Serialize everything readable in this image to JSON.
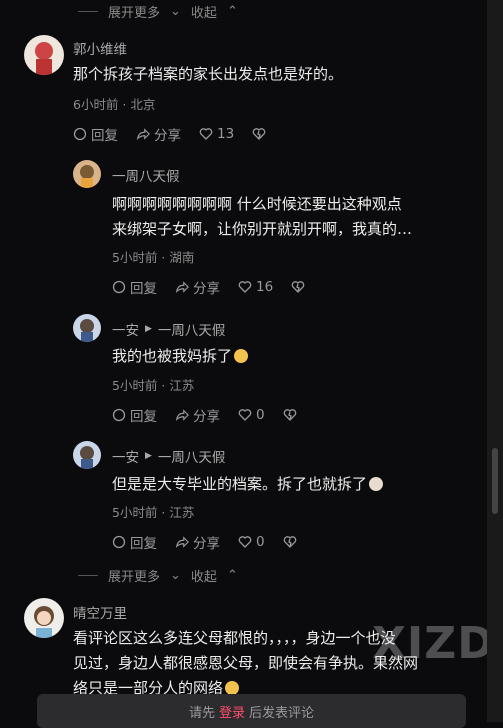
{
  "top_expand": {
    "expand": "展开更多",
    "collapse": "收起"
  },
  "comments": [
    {
      "user": "郭小维维",
      "text": "那个拆孩子档案的家长出发点也是好的。",
      "meta": "6小时前 · 北京",
      "reply": "回复",
      "share": "分享",
      "likes": "13"
    }
  ],
  "replies": [
    {
      "user": "一周八天假",
      "text_lines": [
        "啊啊啊啊啊啊啊啊 什么时候还要出这种观点",
        "来绑架子女啊，让你别开就别开啊，我真的…"
      ],
      "meta": "5小时前 · 湖南",
      "reply": "回复",
      "share": "分享",
      "likes": "16"
    },
    {
      "user": "一安",
      "reply_to": "一周八天假",
      "text": "我的也被我妈拆了",
      "meta": "5小时前 · 江苏",
      "reply": "回复",
      "share": "分享",
      "likes": "0"
    },
    {
      "user": "一安",
      "reply_to": "一周八天假",
      "text": "但是是大专毕业的档案。拆了也就拆了",
      "meta": "5小时前 · 江苏",
      "reply": "回复",
      "share": "分享",
      "likes": "0"
    }
  ],
  "bottom_expand": {
    "expand": "展开更多",
    "collapse": "收起"
  },
  "last_comment": {
    "user": "晴空万里",
    "text_lines": [
      "看评论区这么多连父母都恨的，，，，身边一个也没",
      "见过，身边人都很感恩父母，即使会有争执。果然网",
      "络只是一部分人的网络"
    ]
  },
  "footer": {
    "prefix": "请先",
    "login": "登录",
    "suffix": "后发表评论"
  },
  "watermark": "XIZD"
}
